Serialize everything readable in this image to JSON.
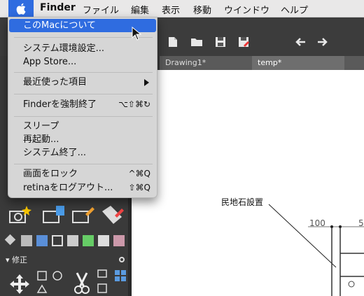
{
  "menubar": {
    "apple_icon": "apple-icon",
    "items": [
      "Finder",
      "ファイル",
      "編集",
      "表示",
      "移動",
      "ウインドウ",
      "ヘルプ"
    ]
  },
  "apple_menu": {
    "items": [
      {
        "label": "このMacについて",
        "shortcut": ""
      },
      {
        "label": "システム環境設定...",
        "shortcut": ""
      },
      {
        "label": "App Store...",
        "shortcut": ""
      },
      {
        "label": "最近使った項目",
        "shortcut": ""
      },
      {
        "label": "Finderを強制終了",
        "shortcut": "⌥⇧⌘↻"
      },
      {
        "label": "スリープ",
        "shortcut": ""
      },
      {
        "label": "再起動...",
        "shortcut": ""
      },
      {
        "label": "システム終了...",
        "shortcut": ""
      },
      {
        "label": "画面をロック",
        "shortcut": "^⌘Q"
      },
      {
        "label": "retinaをログアウト...",
        "shortcut": "⇧⌘Q"
      }
    ]
  },
  "tabs": [
    "Drawing1*",
    "temp*"
  ],
  "panel": {
    "section_label": "修正"
  },
  "canvas": {
    "annotation": "民地石設置",
    "dim_left": "100",
    "dim_right": "5"
  },
  "colors": {
    "accent": "#2f6ce0",
    "menu_bg": "#d6d6d6",
    "app_dark": "#3a3a3a"
  }
}
